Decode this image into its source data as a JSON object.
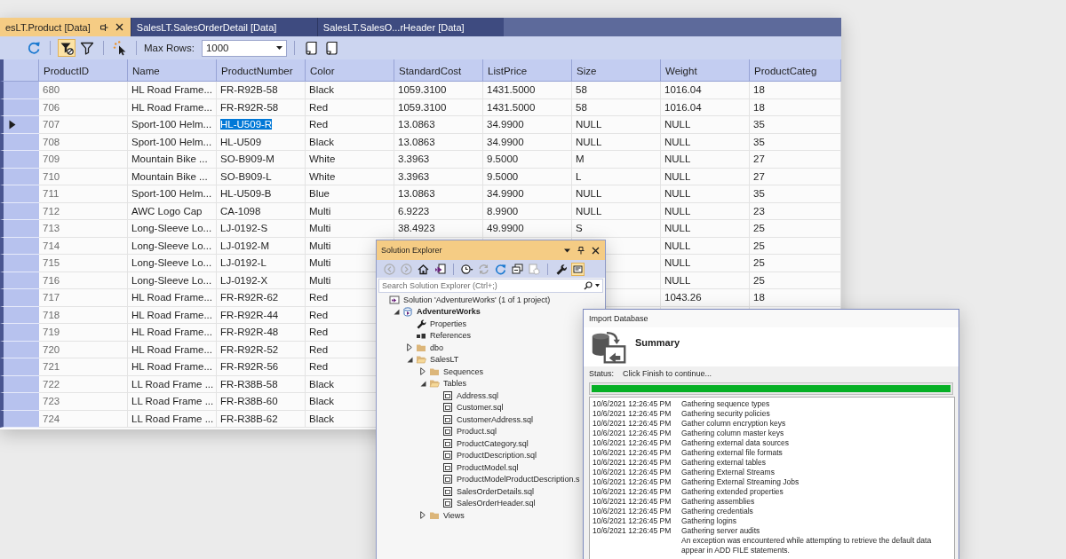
{
  "grid_window": {
    "tabs": [
      {
        "label": "esLT.Product [Data]",
        "selected": true
      },
      {
        "label": "SalesLT.SalesOrderDetail [Data]",
        "selected": false
      },
      {
        "label": "SalesLT.SalesO...rHeader [Data]",
        "selected": false
      }
    ],
    "toolbar": {
      "groups": [
        [
          {
            "kind": "refresh",
            "on": false
          }
        ],
        [
          {
            "kind": "filter_settings",
            "on": true
          },
          {
            "kind": "filter",
            "on": false
          }
        ],
        [
          {
            "kind": "pointer",
            "on": false
          }
        ]
      ],
      "max_rows_label": "Max Rows:",
      "max_rows": "1000",
      "end_group": [
        {
          "kind": "script",
          "on": false
        },
        {
          "kind": "script",
          "on": false
        }
      ]
    },
    "columns": [
      "ProductID",
      "Name",
      "ProductNumber",
      "Color",
      "StandardCost",
      "ListPrice",
      "Size",
      "Weight",
      "ProductCateg"
    ],
    "rows": [
      {
        "current": false,
        "cells": [
          {
            "text": "680",
            "selected": false
          },
          {
            "text": "HL Road Frame...",
            "selected": false
          },
          {
            "text": "FR-R92B-58",
            "selected": false
          },
          {
            "text": "Black",
            "selected": false
          },
          {
            "text": "1059.3100",
            "selected": false
          },
          {
            "text": "1431.5000",
            "selected": false
          },
          {
            "text": "58",
            "selected": false
          },
          {
            "text": "1016.04",
            "selected": false
          },
          {
            "text": "18",
            "selected": false
          }
        ]
      },
      {
        "current": false,
        "cells": [
          {
            "text": "706",
            "selected": false
          },
          {
            "text": "HL Road Frame...",
            "selected": false
          },
          {
            "text": "FR-R92R-58",
            "selected": false
          },
          {
            "text": "Red",
            "selected": false
          },
          {
            "text": "1059.3100",
            "selected": false
          },
          {
            "text": "1431.5000",
            "selected": false
          },
          {
            "text": "58",
            "selected": false
          },
          {
            "text": "1016.04",
            "selected": false
          },
          {
            "text": "18",
            "selected": false
          }
        ]
      },
      {
        "current": true,
        "cells": [
          {
            "text": "707",
            "selected": false
          },
          {
            "text": "Sport-100 Helm...",
            "selected": false
          },
          {
            "text": "HL-U509-R",
            "selected": true
          },
          {
            "text": "Red",
            "selected": false
          },
          {
            "text": "13.0863",
            "selected": false
          },
          {
            "text": "34.9900",
            "selected": false
          },
          {
            "text": "NULL",
            "selected": false
          },
          {
            "text": "NULL",
            "selected": false
          },
          {
            "text": "35",
            "selected": false
          }
        ]
      },
      {
        "current": false,
        "cells": [
          {
            "text": "708",
            "selected": false
          },
          {
            "text": "Sport-100 Helm...",
            "selected": false
          },
          {
            "text": "HL-U509",
            "selected": false
          },
          {
            "text": "Black",
            "selected": false
          },
          {
            "text": "13.0863",
            "selected": false
          },
          {
            "text": "34.9900",
            "selected": false
          },
          {
            "text": "NULL",
            "selected": false
          },
          {
            "text": "NULL",
            "selected": false
          },
          {
            "text": "35",
            "selected": false
          }
        ]
      },
      {
        "current": false,
        "cells": [
          {
            "text": "709",
            "selected": false
          },
          {
            "text": "Mountain Bike ...",
            "selected": false
          },
          {
            "text": "SO-B909-M",
            "selected": false
          },
          {
            "text": "White",
            "selected": false
          },
          {
            "text": "3.3963",
            "selected": false
          },
          {
            "text": "9.5000",
            "selected": false
          },
          {
            "text": "M",
            "selected": false
          },
          {
            "text": "NULL",
            "selected": false
          },
          {
            "text": "27",
            "selected": false
          }
        ]
      },
      {
        "current": false,
        "cells": [
          {
            "text": "710",
            "selected": false
          },
          {
            "text": "Mountain Bike ...",
            "selected": false
          },
          {
            "text": "SO-B909-L",
            "selected": false
          },
          {
            "text": "White",
            "selected": false
          },
          {
            "text": "3.3963",
            "selected": false
          },
          {
            "text": "9.5000",
            "selected": false
          },
          {
            "text": "L",
            "selected": false
          },
          {
            "text": "NULL",
            "selected": false
          },
          {
            "text": "27",
            "selected": false
          }
        ]
      },
      {
        "current": false,
        "cells": [
          {
            "text": "711",
            "selected": false
          },
          {
            "text": "Sport-100 Helm...",
            "selected": false
          },
          {
            "text": "HL-U509-B",
            "selected": false
          },
          {
            "text": "Blue",
            "selected": false
          },
          {
            "text": "13.0863",
            "selected": false
          },
          {
            "text": "34.9900",
            "selected": false
          },
          {
            "text": "NULL",
            "selected": false
          },
          {
            "text": "NULL",
            "selected": false
          },
          {
            "text": "35",
            "selected": false
          }
        ]
      },
      {
        "current": false,
        "cells": [
          {
            "text": "712",
            "selected": false
          },
          {
            "text": "AWC Logo Cap",
            "selected": false
          },
          {
            "text": "CA-1098",
            "selected": false
          },
          {
            "text": "Multi",
            "selected": false
          },
          {
            "text": "6.9223",
            "selected": false
          },
          {
            "text": "8.9900",
            "selected": false
          },
          {
            "text": "NULL",
            "selected": false
          },
          {
            "text": "NULL",
            "selected": false
          },
          {
            "text": "23",
            "selected": false
          }
        ]
      },
      {
        "current": false,
        "cells": [
          {
            "text": "713",
            "selected": false
          },
          {
            "text": "Long-Sleeve Lo...",
            "selected": false
          },
          {
            "text": "LJ-0192-S",
            "selected": false
          },
          {
            "text": "Multi",
            "selected": false
          },
          {
            "text": "38.4923",
            "selected": false
          },
          {
            "text": "49.9900",
            "selected": false
          },
          {
            "text": "S",
            "selected": false
          },
          {
            "text": "NULL",
            "selected": false
          },
          {
            "text": "25",
            "selected": false
          }
        ]
      },
      {
        "current": false,
        "cells": [
          {
            "text": "714",
            "selected": false
          },
          {
            "text": "Long-Sleeve Lo...",
            "selected": false
          },
          {
            "text": "LJ-0192-M",
            "selected": false
          },
          {
            "text": "Multi",
            "selected": false
          },
          null,
          null,
          {
            "selected": false
          },
          {
            "text": "NULL",
            "selected": false
          },
          {
            "text": "25",
            "selected": false
          }
        ]
      },
      {
        "current": false,
        "cells": [
          {
            "text": "715",
            "selected": false
          },
          {
            "text": "Long-Sleeve Lo...",
            "selected": false
          },
          {
            "text": "LJ-0192-L",
            "selected": false
          },
          {
            "text": "Multi",
            "selected": false
          },
          null,
          null,
          {
            "selected": false
          },
          {
            "text": "NULL",
            "selected": false
          },
          {
            "text": "25",
            "selected": false
          }
        ]
      },
      {
        "current": false,
        "cells": [
          {
            "text": "716",
            "selected": false
          },
          {
            "text": "Long-Sleeve Lo...",
            "selected": false
          },
          {
            "text": "LJ-0192-X",
            "selected": false
          },
          {
            "text": "Multi",
            "selected": false
          },
          null,
          null,
          {
            "selected": false
          },
          {
            "text": "NULL",
            "selected": false
          },
          {
            "text": "25",
            "selected": false
          }
        ]
      },
      {
        "current": false,
        "cells": [
          {
            "text": "717",
            "selected": false
          },
          {
            "text": "HL Road Frame...",
            "selected": false
          },
          {
            "text": "FR-R92R-62",
            "selected": false
          },
          {
            "text": "Red",
            "selected": false
          },
          null,
          null,
          {
            "selected": false
          },
          {
            "text": "1043.26",
            "selected": false
          },
          {
            "text": "18",
            "selected": false
          }
        ]
      },
      {
        "current": false,
        "cells": [
          {
            "text": "718",
            "selected": false
          },
          {
            "text": "HL Road Frame...",
            "selected": false
          },
          {
            "text": "FR-R92R-44",
            "selected": false
          },
          {
            "text": "Red",
            "selected": false
          },
          null,
          null,
          null,
          null,
          null
        ]
      },
      {
        "current": false,
        "cells": [
          {
            "text": "719",
            "selected": false
          },
          {
            "text": "HL Road Frame...",
            "selected": false
          },
          {
            "text": "FR-R92R-48",
            "selected": false
          },
          {
            "text": "Red",
            "selected": false
          },
          null,
          null,
          null,
          null,
          null
        ]
      },
      {
        "current": false,
        "cells": [
          {
            "text": "720",
            "selected": false
          },
          {
            "text": "HL Road Frame...",
            "selected": false
          },
          {
            "text": "FR-R92R-52",
            "selected": false
          },
          {
            "text": "Red",
            "selected": false
          },
          null,
          null,
          null,
          null,
          null
        ]
      },
      {
        "current": false,
        "cells": [
          {
            "text": "721",
            "selected": false
          },
          {
            "text": "HL Road Frame...",
            "selected": false
          },
          {
            "text": "FR-R92R-56",
            "selected": false
          },
          {
            "text": "Red",
            "selected": false
          },
          null,
          null,
          null,
          null,
          null
        ]
      },
      {
        "current": false,
        "cells": [
          {
            "text": "722",
            "selected": false
          },
          {
            "text": "LL Road Frame ...",
            "selected": false
          },
          {
            "text": "FR-R38B-58",
            "selected": false
          },
          {
            "text": "Black",
            "selected": false
          },
          null,
          null,
          null,
          null,
          null
        ]
      },
      {
        "current": false,
        "cells": [
          {
            "text": "723",
            "selected": false
          },
          {
            "text": "LL Road Frame ...",
            "selected": false
          },
          {
            "text": "FR-R38B-60",
            "selected": false
          },
          {
            "text": "Black",
            "selected": false
          },
          null,
          null,
          null,
          null,
          null
        ]
      },
      {
        "current": false,
        "cells": [
          {
            "text": "724",
            "selected": false
          },
          {
            "text": "LL Road Frame ...",
            "selected": false
          },
          {
            "text": "FR-R38B-62",
            "selected": false
          },
          {
            "text": "Black",
            "selected": false
          },
          null,
          null,
          null,
          null,
          null
        ]
      }
    ]
  },
  "solution_explorer": {
    "title": "Solution Explorer",
    "toolbar": {
      "groups": [
        [
          {
            "kind": "back",
            "on": false,
            "disabled": true
          },
          {
            "kind": "forward",
            "on": false,
            "disabled": true
          },
          {
            "kind": "home",
            "on": false,
            "disabled": false
          },
          {
            "kind": "switch_views",
            "on": false,
            "disabled": false
          }
        ],
        [
          {
            "kind": "pending_changes",
            "on": false,
            "disabled": false
          },
          {
            "kind": "sync",
            "on": false,
            "disabled": true
          },
          {
            "kind": "refresh",
            "on": false,
            "disabled": false
          },
          {
            "kind": "collapse",
            "on": false,
            "disabled": false
          },
          {
            "kind": "properties",
            "on": false,
            "disabled": true
          }
        ],
        [
          {
            "kind": "wrench",
            "on": false,
            "disabled": false
          },
          {
            "kind": "preview",
            "on": true,
            "disabled": false
          }
        ]
      ]
    },
    "search": {
      "placeholder": "Search Solution Explorer (Ctrl+;)"
    },
    "tree": [
      {
        "kind": "solution",
        "label": "Solution 'AdventureWorks' (1 of 1 project)",
        "children": [
          {
            "kind": "project",
            "label": "AdventureWorks",
            "expanded": true,
            "children": [
              {
                "kind": "properties",
                "label": "Properties"
              },
              {
                "kind": "references",
                "label": "References"
              },
              {
                "kind": "folder",
                "label": "dbo",
                "expanded": false
              },
              {
                "kind": "folder",
                "label": "SalesLT",
                "expanded": true,
                "children": [
                  {
                    "kind": "folder",
                    "label": "Sequences",
                    "expanded": false
                  },
                  {
                    "kind": "folder",
                    "label": "Tables",
                    "expanded": true,
                    "children": [
                      {
                        "kind": "file",
                        "label": "Address.sql"
                      },
                      {
                        "kind": "file",
                        "label": "Customer.sql"
                      },
                      {
                        "kind": "file",
                        "label": "CustomerAddress.sql"
                      },
                      {
                        "kind": "file",
                        "label": "Product.sql"
                      },
                      {
                        "kind": "file",
                        "label": "ProductCategory.sql"
                      },
                      {
                        "kind": "file",
                        "label": "ProductDescription.sql"
                      },
                      {
                        "kind": "file",
                        "label": "ProductModel.sql"
                      },
                      {
                        "kind": "file",
                        "label": "ProductModelProductDescription.s"
                      },
                      {
                        "kind": "file",
                        "label": "SalesOrderDetails.sql"
                      },
                      {
                        "kind": "file",
                        "label": "SalesOrderHeader.sql"
                      }
                    ]
                  },
                  {
                    "kind": "folder",
                    "label": "Views",
                    "expanded": false
                  }
                ]
              }
            ]
          }
        ]
      }
    ]
  },
  "import_dialog": {
    "title": "Import Database",
    "heading": "Summary",
    "status_label": "Status:",
    "status": "Click Finish to continue...",
    "progress": {
      "level": 1
    },
    "log": [
      {
        "time": "10/6/2021 12:26:45 PM",
        "message": "Gathering sequence types"
      },
      {
        "time": "10/6/2021 12:26:45 PM",
        "message": "Gathering security policies"
      },
      {
        "time": "10/6/2021 12:26:45 PM",
        "message": "Gather column encryption keys"
      },
      {
        "time": "10/6/2021 12:26:45 PM",
        "message": "Gathering column master keys"
      },
      {
        "time": "10/6/2021 12:26:45 PM",
        "message": "Gathering external data sources"
      },
      {
        "time": "10/6/2021 12:26:45 PM",
        "message": "Gathering external file formats"
      },
      {
        "time": "10/6/2021 12:26:45 PM",
        "message": "Gathering external tables"
      },
      {
        "time": "10/6/2021 12:26:45 PM",
        "message": "Gathering External Streams"
      },
      {
        "time": "10/6/2021 12:26:45 PM",
        "message": "Gathering External Streaming Jobs"
      },
      {
        "time": "10/6/2021 12:26:45 PM",
        "message": "Gathering extended properties"
      },
      {
        "time": "10/6/2021 12:26:45 PM",
        "message": "Gathering assemblies"
      },
      {
        "time": "10/6/2021 12:26:45 PM",
        "message": "Gathering credentials"
      },
      {
        "time": "10/6/2021 12:26:45 PM",
        "message": "Gathering logins"
      },
      {
        "time": "10/6/2021 12:26:45 PM",
        "message": "Gathering server audits"
      },
      {
        "message": "An exception was encountered while attempting to retrieve the default data"
      },
      {
        "message": "appear in ADD FILE statements."
      }
    ]
  }
}
